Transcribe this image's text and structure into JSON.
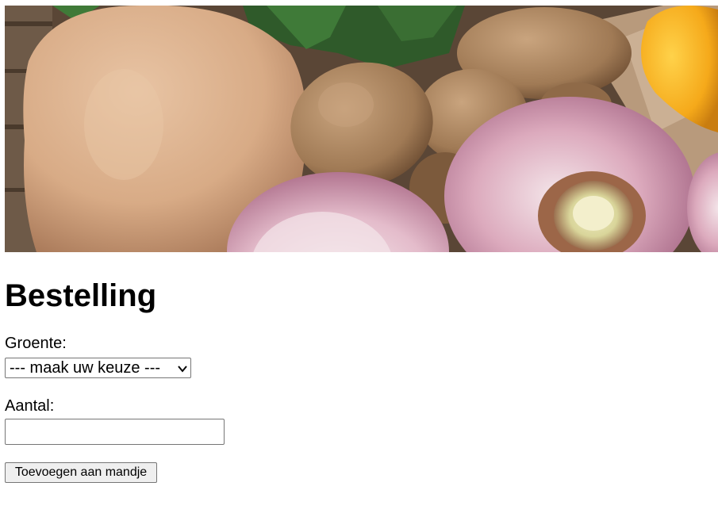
{
  "hero": {
    "image": "vegetables-photo",
    "content": [
      "turnips",
      "potatoes",
      "yellow-pepper",
      "leafy-greens"
    ]
  },
  "page": {
    "title": "Bestelling"
  },
  "form": {
    "groente_label": "Groente:",
    "groente_selected": "--- maak uw keuze ---",
    "aantal_label": "Aantal:",
    "aantal_value": "",
    "submit_label": "Toevoegen aan mandje"
  },
  "colors": {
    "field_border": "#767676",
    "button_bg": "#efefef",
    "text": "#000000"
  },
  "icons": {
    "select_arrow": "chevron-down-icon"
  }
}
